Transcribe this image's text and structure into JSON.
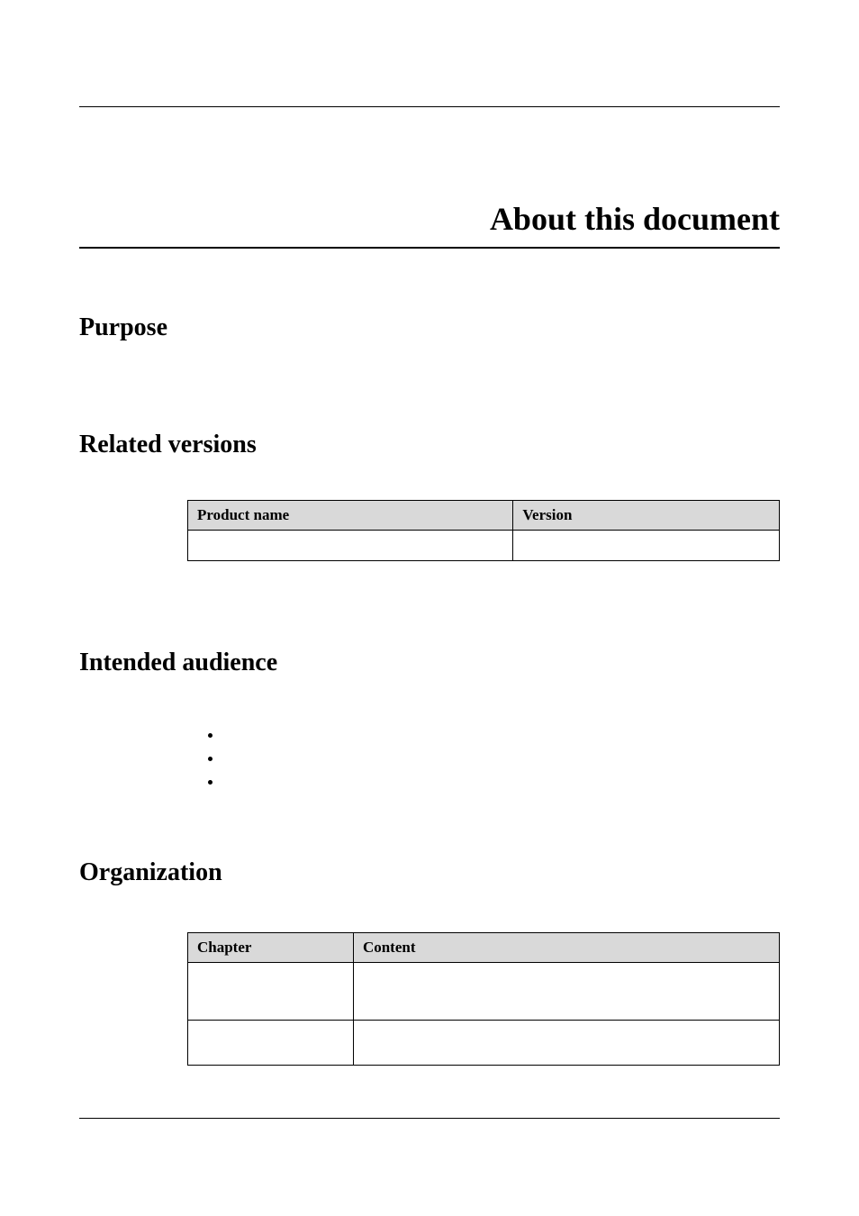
{
  "title": "About this document",
  "sections": {
    "purpose": {
      "heading": "Purpose"
    },
    "related_versions": {
      "heading": "Related versions",
      "headers": {
        "product": "Product name",
        "version": "Version"
      },
      "rows": [
        {
          "product": "",
          "version": ""
        }
      ]
    },
    "intended_audience": {
      "heading": "Intended audience",
      "items": [
        "",
        "",
        ""
      ]
    },
    "organization": {
      "heading": "Organization",
      "headers": {
        "chapter": "Chapter",
        "content": "Content"
      },
      "rows": [
        {
          "chapter": "",
          "content": ""
        },
        {
          "chapter": "",
          "content": ""
        }
      ]
    }
  }
}
